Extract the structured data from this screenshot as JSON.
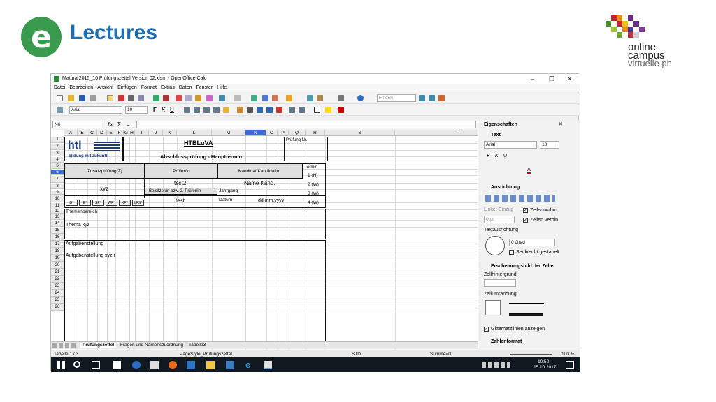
{
  "brand": {
    "logo_text": "Lectures",
    "oc_line1": "online",
    "oc_line2": "campus",
    "oc_line3": "virtuelle ph"
  },
  "window": {
    "title": "Matura 2015_16 Prüfungszettel Version 02.xlsm - OpenOffice Calc",
    "menu": [
      "Datei",
      "Bearbeiten",
      "Ansicht",
      "Einfügen",
      "Format",
      "Extras",
      "Daten",
      "Fenster",
      "Hilfe"
    ],
    "font_name": "Arial",
    "font_size": "10",
    "find_placeholder": "Finden",
    "name_box": "N6"
  },
  "sheet": {
    "columns": [
      "A",
      "B",
      "C",
      "D",
      "E",
      "F",
      "G",
      "H",
      "I",
      "J",
      "K",
      "L",
      "M",
      "N",
      "O",
      "P",
      "Q",
      "R",
      "S",
      "T"
    ],
    "rows": [
      "1",
      "2",
      "3",
      "4",
      "5",
      "6",
      "7",
      "8",
      "9",
      "10",
      "11",
      "12",
      "13",
      "14",
      "15",
      "16",
      "17",
      "18",
      "19",
      "20",
      "21",
      "22",
      "23",
      "24",
      "25",
      "26"
    ],
    "htl": "htl",
    "htl_sub": "bildung mit zukunft",
    "school": "HTBLuVA",
    "exam": "Abschlussprüfung - Haupttermin",
    "pruefung_nr": "Prüfung Nr.",
    "zusatz": "Zusatzprüfung(Z)",
    "pruefer": "Prüfer/in",
    "kandidat": "Kandidat/Kandidatin",
    "termin": "Termin",
    "t1": "1 (H)",
    "t2": "2 (W)",
    "t3": "3 (W)",
    "t4": "4 (W)",
    "xyz": "xyz",
    "test2": "test2",
    "name_kand": "Name Kand.",
    "beisitzer": "Beisitzer/in bzw. 2. Prüfer/in",
    "jahrgang": "Jahrgang",
    "test": "test",
    "datum": "Datum",
    "date_fmt": "dd.mm.yyyy",
    "grades": [
      "D°",
      "E°",
      "SP°",
      "WP°",
      "KP°",
      "LFS°"
    ],
    "themenbereich": "Themenbereich",
    "thema": "Thema xyz",
    "aufgabenstellung": "Aufgabenstellung",
    "aufgabe": "Aufgabenstellung xyz r"
  },
  "tabs": [
    "Prüfungszettel",
    "Fragen und Namenszuordnung",
    "Tabelle3"
  ],
  "sidebar": {
    "title": "Eigenschaften",
    "text": "Text",
    "font": "Arial",
    "size": "10",
    "ausrichtung": "Ausrichtung",
    "linker_einzug": "Linker Einzug",
    "einzug_val": "0 pt",
    "zeilenumbruch": "Zeilenumbru",
    "zellen_verbinden": "Zellen verbin",
    "textausrichtung": "Textausrichtung",
    "grad": "0 Grad",
    "senkrecht": "Senkrecht gestapelt",
    "erscheinungsbild": "Erscheinungsbild der Zelle",
    "zellhintergrund": "Zellhintergrund:",
    "zellumrandung": "Zellumrandung:",
    "gitternetz": "Gitternetzlinien anzeigen",
    "zahlenformat": "Zahlenformat"
  },
  "status": {
    "sheet": "Tabelle 1 / 3",
    "style": "PageStyle_Prüfungszettel",
    "std": "STD",
    "sum": "Summe=0",
    "zoom": "100 %"
  },
  "clock": {
    "time": "10:52",
    "date": "15.10.2017"
  }
}
